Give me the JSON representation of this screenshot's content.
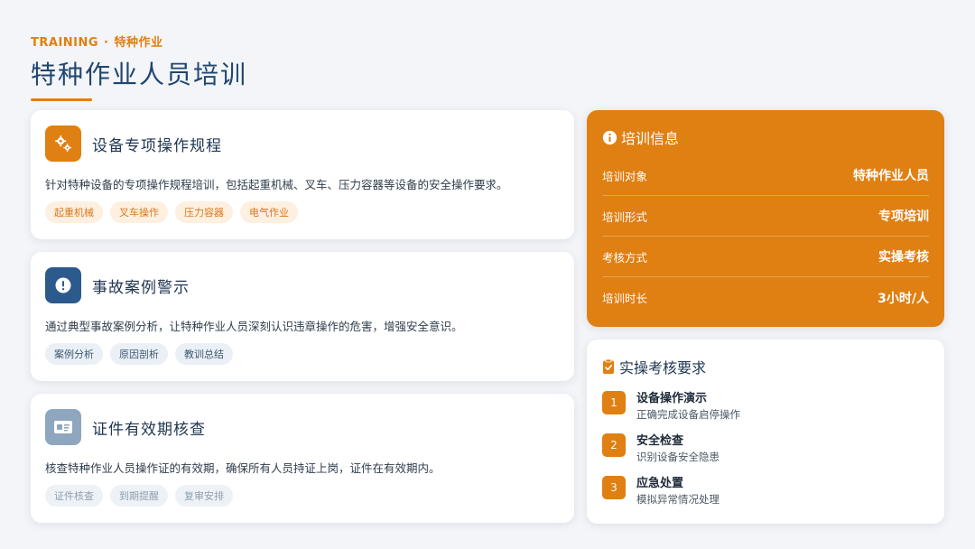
{
  "header": {
    "eyebrow_en": "TRAINING",
    "eyebrow_sep": "·",
    "eyebrow_cn": "特种作业",
    "title": "特种作业人员培训"
  },
  "cards": [
    {
      "title": "设备专项操作规程",
      "desc": "针对特种设备的专项操作规程培训，包括起重机械、叉车、压力容器等设备的安全操作要求。",
      "icon": "gears-icon",
      "icon_bg": "#e07f12",
      "tags": [
        "起重机械",
        "叉车操作",
        "压力容器",
        "电气作业"
      ]
    },
    {
      "title": "事故案例警示",
      "desc": "通过典型事故案例分析，让特种作业人员深刻认识违章操作的危害，增强安全意识。",
      "icon": "alert-icon",
      "icon_bg": "#2c5a8c",
      "tags": [
        "案例分析",
        "原因剖析",
        "教训总结"
      ]
    },
    {
      "title": "证件有效期核查",
      "desc": "核查特种作业人员操作证的有效期，确保所有人员持证上岗，证件在有效期内。",
      "icon": "id-card-icon",
      "icon_bg": "#8fa6bf",
      "tags": [
        "证件核查",
        "到期提醒",
        "复审安排"
      ]
    }
  ],
  "info": {
    "title": "培训信息",
    "rows": [
      {
        "label": "培训对象",
        "value": "特种作业人员"
      },
      {
        "label": "培训形式",
        "value": "专项培训"
      },
      {
        "label": "考核方式",
        "value": "实操考核"
      },
      {
        "label": "培训时长",
        "value": "3小时/人"
      }
    ]
  },
  "requirements": {
    "title": "实操考核要求",
    "items": [
      {
        "num": "1",
        "name": "设备操作演示",
        "desc": "正确完成设备启停操作"
      },
      {
        "num": "2",
        "name": "安全检查",
        "desc": "识别设备安全隐患"
      },
      {
        "num": "3",
        "name": "应急处置",
        "desc": "模拟异常情况处理"
      }
    ]
  },
  "colors": {
    "accent": "#e07f12",
    "navy": "#1f4570",
    "tag_orange_bg": "#fdf0e1",
    "tag_orange_fg": "#d9771a",
    "tag_blue_bg": "#eaf0f6",
    "tag_blue_fg": "#3e5670",
    "tag_grey_bg": "#eef2f6",
    "tag_grey_fg": "#8fa0b2"
  }
}
